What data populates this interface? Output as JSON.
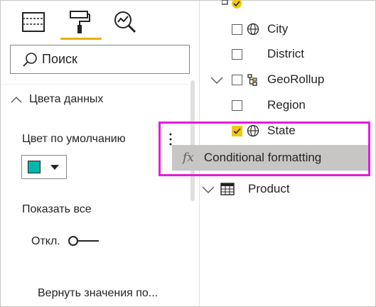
{
  "format_pane": {
    "search": {
      "placeholder": "Поиск"
    },
    "section": {
      "title": "Цвета данных"
    },
    "default_color": {
      "label": "Цвет по умолчанию",
      "swatch_color": "#01b8aa"
    },
    "show_all": {
      "label": "Показать все",
      "toggle_state": "Откл."
    },
    "revert": {
      "label": "Вернуть значения по..."
    }
  },
  "fields": {
    "items": [
      {
        "label": "City",
        "icon": "globe-icon",
        "checked": false
      },
      {
        "label": "District",
        "icon": "",
        "checked": false
      },
      {
        "label": "GeoRollup",
        "icon": "hierarchy-icon",
        "checked": false
      },
      {
        "label": "Region",
        "icon": "",
        "checked": false
      },
      {
        "label": "State",
        "icon": "globe-icon",
        "checked": true
      }
    ],
    "table": {
      "label": "Product",
      "icon": "table-icon"
    }
  },
  "context_menu": {
    "icon": "fx",
    "item_label": "Conditional formatting"
  },
  "colors": {
    "accent": "#e8b000",
    "highlight": "#e51bdc",
    "checkbox_checked": "#f2c811"
  }
}
